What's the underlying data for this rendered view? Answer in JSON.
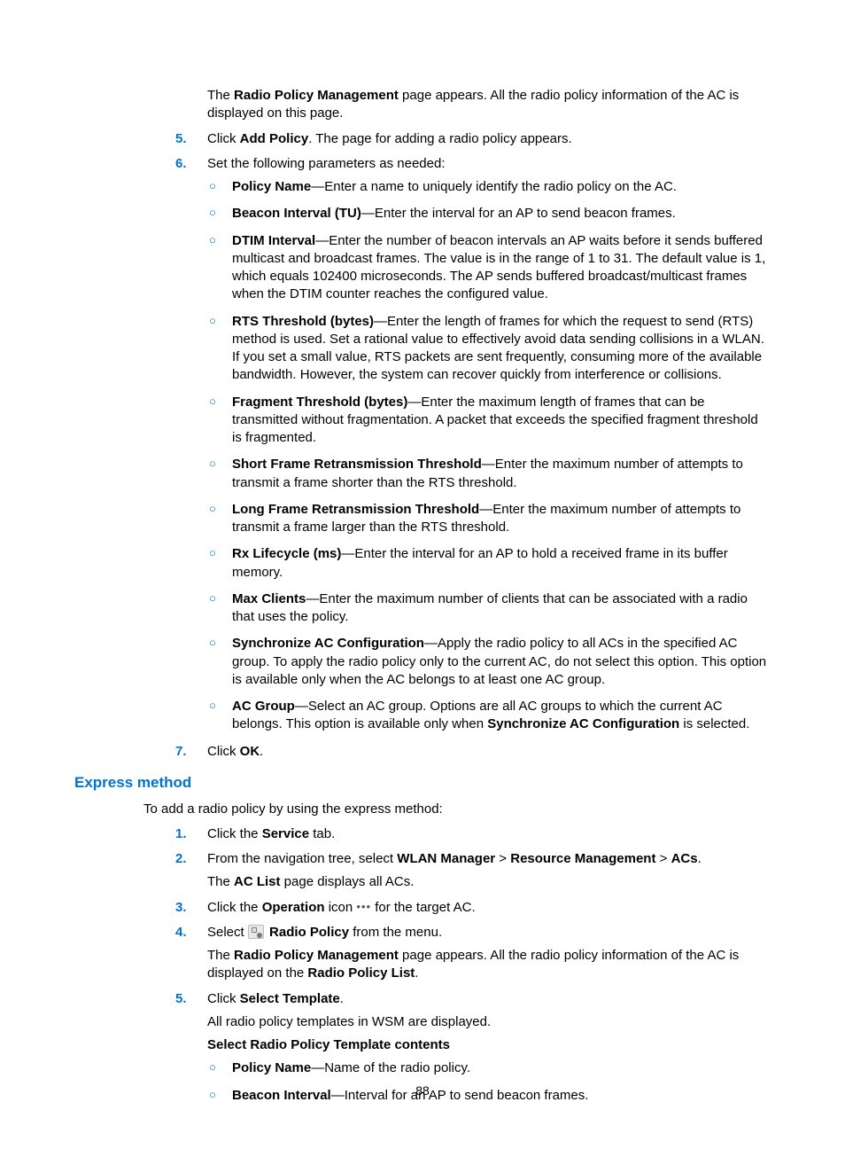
{
  "pageNumber": "88",
  "section1": {
    "intro_p": [
      "The ",
      "Radio Policy Management",
      " page appears. All the radio policy information of the AC is displayed on this page."
    ],
    "items": [
      {
        "num": "5.",
        "runs": [
          "Click ",
          "Add Policy",
          ". The page for adding a radio policy appears."
        ]
      },
      {
        "num": "6.",
        "runs": [
          "Set the following parameters as needed:"
        ],
        "bullets": [
          {
            "b": "Policy Name",
            "t": "—Enter a name to uniquely identify the radio policy on the AC."
          },
          {
            "b": "Beacon Interval (TU)",
            "t": "—Enter the interval for an AP to send beacon frames."
          },
          {
            "b": "DTIM Interval",
            "t": "—Enter the number of beacon intervals an AP waits before it sends buffered multicast and broadcast frames. The value is in the range of 1 to 31. The default value is 1, which equals 102400 microseconds. The AP sends buffered broadcast/multicast frames when the DTIM counter reaches the configured value."
          },
          {
            "b": "RTS Threshold (bytes)",
            "t": "—Enter the length of frames for which the request to send (RTS) method is used. Set a rational value to effectively avoid data sending collisions in a WLAN. If you set a small value, RTS packets are sent frequently, consuming more of the available bandwidth. However, the system can recover quickly from interference or collisions."
          },
          {
            "b": "Fragment Threshold (bytes)",
            "t": "—Enter the maximum length of frames that can be transmitted without fragmentation. A packet that exceeds the specified fragment threshold is fragmented."
          },
          {
            "b": "Short Frame Retransmission Threshold",
            "t": "—Enter the maximum number of attempts to transmit a frame shorter than the RTS threshold."
          },
          {
            "b": "Long Frame Retransmission Threshold",
            "t": "—Enter the maximum number of attempts to transmit a frame larger than the RTS threshold."
          },
          {
            "b": "Rx Lifecycle (ms)",
            "t": "—Enter the interval for an AP to hold a received frame in its buffer memory."
          },
          {
            "b": "Max Clients",
            "t": "—Enter the maximum number of clients that can be associated with a radio that uses the policy."
          },
          {
            "b": "Synchronize AC Configuration",
            "t": "—Apply the radio policy to all ACs in the specified AC group. To apply the radio policy only to the current AC, do not select this option. This option is available only when the AC belongs to at least one AC group."
          },
          {
            "b": "AC Group",
            "t1": "—Select an AC group. Options are all AC groups to which the current AC belongs. This option is available only when ",
            "b2": "Synchronize AC Configuration",
            "t2": " is selected."
          }
        ]
      },
      {
        "num": "7.",
        "runs": [
          "Click ",
          "OK",
          "."
        ]
      }
    ]
  },
  "expressHeading": "Express method",
  "expressIntro": "To add a radio policy by using the express method:",
  "section2": {
    "items": [
      {
        "num": "1.",
        "p1": [
          "Click the ",
          "Service",
          " tab."
        ]
      },
      {
        "num": "2.",
        "p1_nav": {
          "pre": "From the navigation tree, select ",
          "a": "WLAN Manager",
          "sep1": " > ",
          "b": "Resource Management",
          "sep2": " > ",
          "c": "ACs",
          "post": "."
        },
        "p2": [
          "The ",
          "AC List",
          " page displays all ACs."
        ]
      },
      {
        "num": "3.",
        "p1_icon": {
          "pre": "Click the ",
          "b": "Operation",
          "mid": " icon ",
          "post": " for the target AC."
        }
      },
      {
        "num": "4.",
        "p1_icon2": {
          "pre": "Select ",
          "b": "Radio Policy",
          "post": " from the menu."
        },
        "p2": [
          "The ",
          "Radio Policy Management",
          " page appears. All the radio policy information of the AC is displayed on the ",
          "Radio Policy List",
          "."
        ]
      },
      {
        "num": "5.",
        "p1": [
          "Click ",
          "Select Template",
          "."
        ],
        "p2plain": "All radio policy templates in WSM are displayed.",
        "subhead": "Select Radio Policy Template contents",
        "bullets": [
          {
            "b": "Policy Name",
            "t": "—Name of the radio policy."
          },
          {
            "b": "Beacon Interval",
            "t": "—Interval for an AP to send beacon frames."
          }
        ]
      }
    ]
  }
}
